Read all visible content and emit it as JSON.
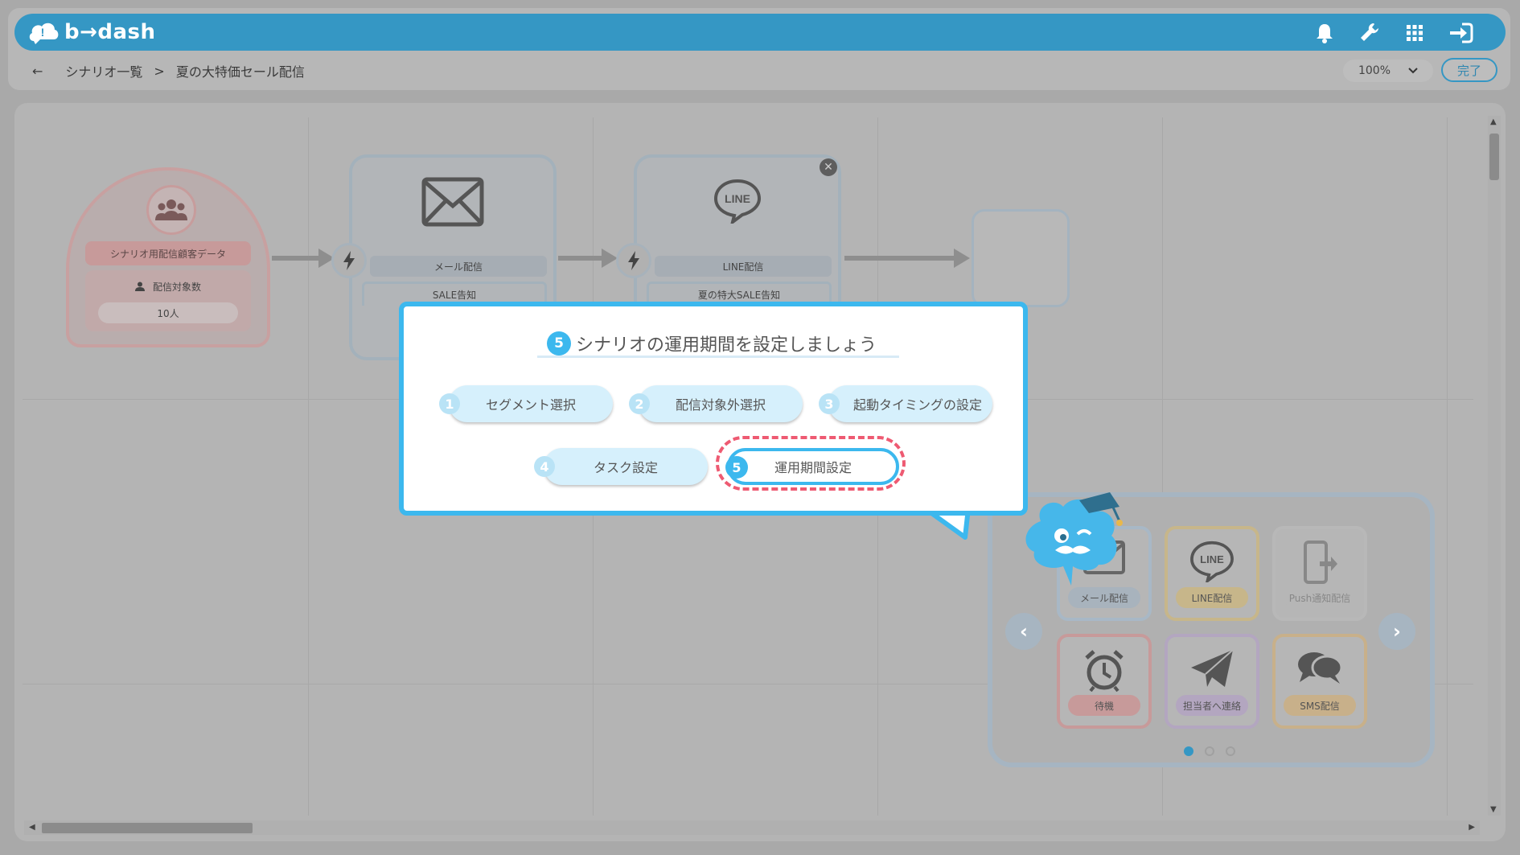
{
  "app": {
    "logo_text": "b→dash"
  },
  "header": {
    "icons": [
      "bell-icon",
      "wrench-icon",
      "grid-icon",
      "login-icon"
    ]
  },
  "breadcrumb": {
    "back": "←",
    "parent": "シナリオ一覧",
    "separator": ">",
    "current": "夏の大特価セール配信"
  },
  "toolbar": {
    "zoom": "100%",
    "done_label": "完了"
  },
  "canvas": {
    "segment_node": {
      "title": "シナリオ用配信顧客データ",
      "count_label": "配信対象数",
      "count_value": "10人"
    },
    "mail_node": {
      "label": "メール配信",
      "sub": "SALE告知"
    },
    "line_node": {
      "label": "LINE配信",
      "sub": "夏の特大SALE告知",
      "icon_text": "LINE"
    }
  },
  "palette": {
    "tiles": [
      {
        "label": "メール配信",
        "icon": "mail-icon",
        "color": "#a8b3bd"
      },
      {
        "label": "LINE配信",
        "icon": "line-icon",
        "color": "#c7b68a"
      },
      {
        "label": "Push通知配信",
        "icon": "phone-push-icon",
        "color": "#b6b6b6"
      },
      {
        "label": "待機",
        "icon": "alarm-clock-icon",
        "color": "#c79a9a"
      },
      {
        "label": "担当者へ連絡",
        "icon": "paper-plane-icon",
        "color": "#b3a6c0"
      },
      {
        "label": "SMS配信",
        "icon": "chat-bubbles-icon",
        "color": "#c8b08a"
      }
    ],
    "line_tile_icon_text": "LINE",
    "page_count": 3,
    "current_page": 1
  },
  "popup": {
    "title_num": "5",
    "title": "シナリオの運用期間を設定しましょう",
    "steps": [
      {
        "num": "1",
        "label": "セグメント選択"
      },
      {
        "num": "2",
        "label": "配信対象外選択"
      },
      {
        "num": "3",
        "label": "起動タイミングの設定"
      },
      {
        "num": "4",
        "label": "タスク設定"
      },
      {
        "num": "5",
        "label": "運用期間設定"
      }
    ],
    "active_step": 5
  },
  "colors": {
    "header_blue": "#3597c4",
    "popup_border": "#3cb8ee",
    "highlight": "#ee5a72"
  }
}
